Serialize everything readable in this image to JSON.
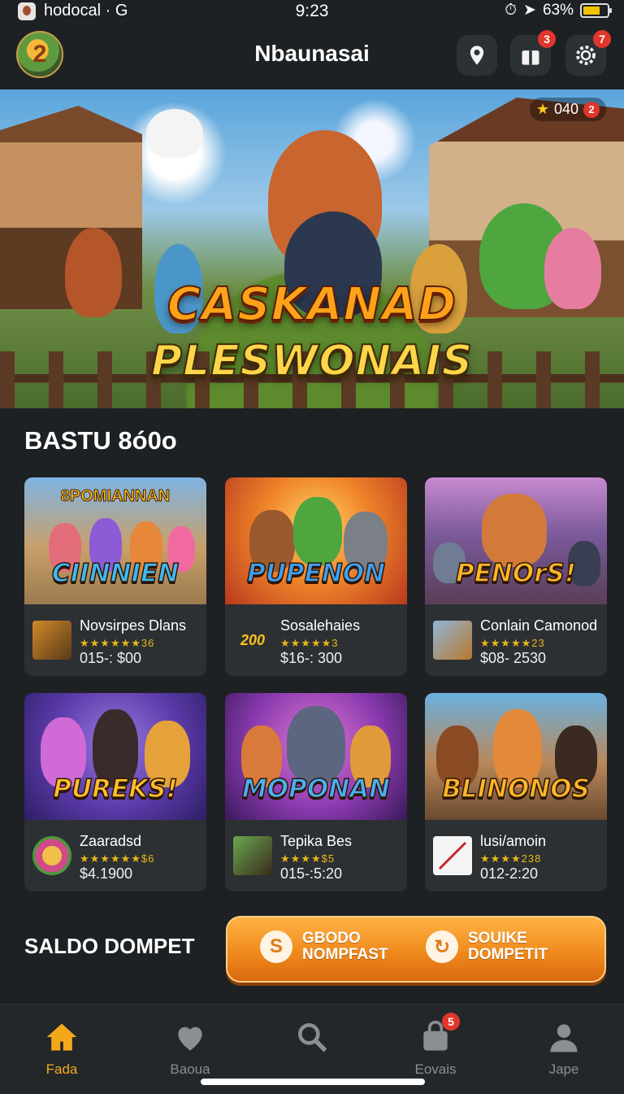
{
  "status_bar": {
    "app_text": "hodocal · G",
    "time": "9:23",
    "battery": "63%",
    "battery_level": 0.63
  },
  "header": {
    "title": "Nbaunasai",
    "notifications_badge": "3",
    "settings_badge": "7"
  },
  "hero": {
    "title_line1": "CASKANAD",
    "title_line2": "PLESWONAIS",
    "coin_count": "040",
    "coin_badge": "2"
  },
  "section": {
    "title": "BASTU 8ó0o"
  },
  "games": [
    {
      "art_title": "CIINNIEN",
      "art_top": "8POMIANNAN",
      "name": "Novsirpes Dlans",
      "stars": "★★★★★★36",
      "price": "015-: $00"
    },
    {
      "art_title": "PUPENON",
      "art_top": "",
      "name": "Sosalehaies",
      "stars": "★★★★★3",
      "price": "$16-: 300",
      "thumb_text": "200"
    },
    {
      "art_title": "PENOrS!",
      "art_top": "",
      "name": "Conlain Camonod",
      "stars": "★★★★★23",
      "price": "$08- 2530"
    },
    {
      "art_title": "PUREKS!",
      "art_top": "",
      "name": "Zaaradsd",
      "stars": "★★★★★★$6",
      "price": "$4.1900"
    },
    {
      "art_title": "MOPONAN",
      "art_top": "",
      "name": "Tepika Bes",
      "stars": "★★★★$5",
      "price": "015-:5:20"
    },
    {
      "art_title": "BLINONOS",
      "art_top": "",
      "name": "lusi/amoin",
      "stars": "★★★★238",
      "price": "012-2:20"
    }
  ],
  "wallet": {
    "label": "SALDO DOMPET",
    "left_line1": "GBODO",
    "left_line2": "NOMPFAST",
    "right_line1": "SOUIKE",
    "right_line2": "DOMPETIT"
  },
  "nav": [
    {
      "label": "Fada",
      "icon": "home-icon",
      "active": true
    },
    {
      "label": "Baoua",
      "icon": "heart-icon"
    },
    {
      "label": "",
      "icon": "search-icon"
    },
    {
      "label": "Eovais",
      "icon": "bag-icon",
      "badge": "5"
    },
    {
      "label": "Jape",
      "icon": "profile-icon"
    }
  ],
  "colors": {
    "accent": "#f3a81c",
    "badge": "#e0362b",
    "background": "#1d2124",
    "card": "#2c3033"
  }
}
